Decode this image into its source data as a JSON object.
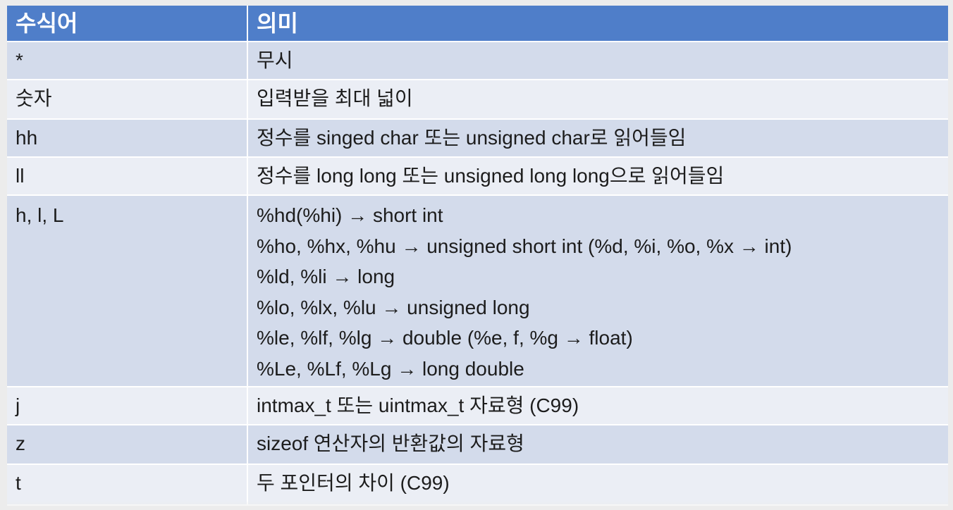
{
  "table": {
    "headers": [
      "수식어",
      "의미"
    ],
    "rows": [
      {
        "modifier": "*",
        "meaning": [
          "무시"
        ]
      },
      {
        "modifier": "숫자",
        "meaning": [
          "입력받을 최대 넓이"
        ]
      },
      {
        "modifier": "hh",
        "meaning": [
          "정수를 singed char 또는 unsigned char로 읽어들임"
        ]
      },
      {
        "modifier": "ll",
        "meaning": [
          "정수를 long long 또는 unsigned long long으로 읽어들임"
        ]
      },
      {
        "modifier": "h, l, L",
        "meaning": [
          "%hd(%hi) → short int",
          "%ho, %hx, %hu → unsigned short int (%d, %i, %o, %x → int)",
          "%ld, %li → long",
          "%lo, %lx, %lu → unsigned long",
          "%le, %lf, %lg → double (%e, f, %g → float)",
          "%Le, %Lf, %Lg → long double"
        ]
      },
      {
        "modifier": "j",
        "meaning": [
          "intmax_t 또는 uintmax_t 자료형 (C99)"
        ]
      },
      {
        "modifier": "z",
        "meaning": [
          "sizeof 연산자의 반환값의 자료형"
        ]
      },
      {
        "modifier": "t",
        "meaning": [
          "두 포인터의 차이 (C99)"
        ]
      }
    ]
  },
  "colors": {
    "header_bg": "#4f7ec9",
    "row_odd_bg": "#d3dbeb",
    "row_even_bg": "#ebeef5"
  }
}
